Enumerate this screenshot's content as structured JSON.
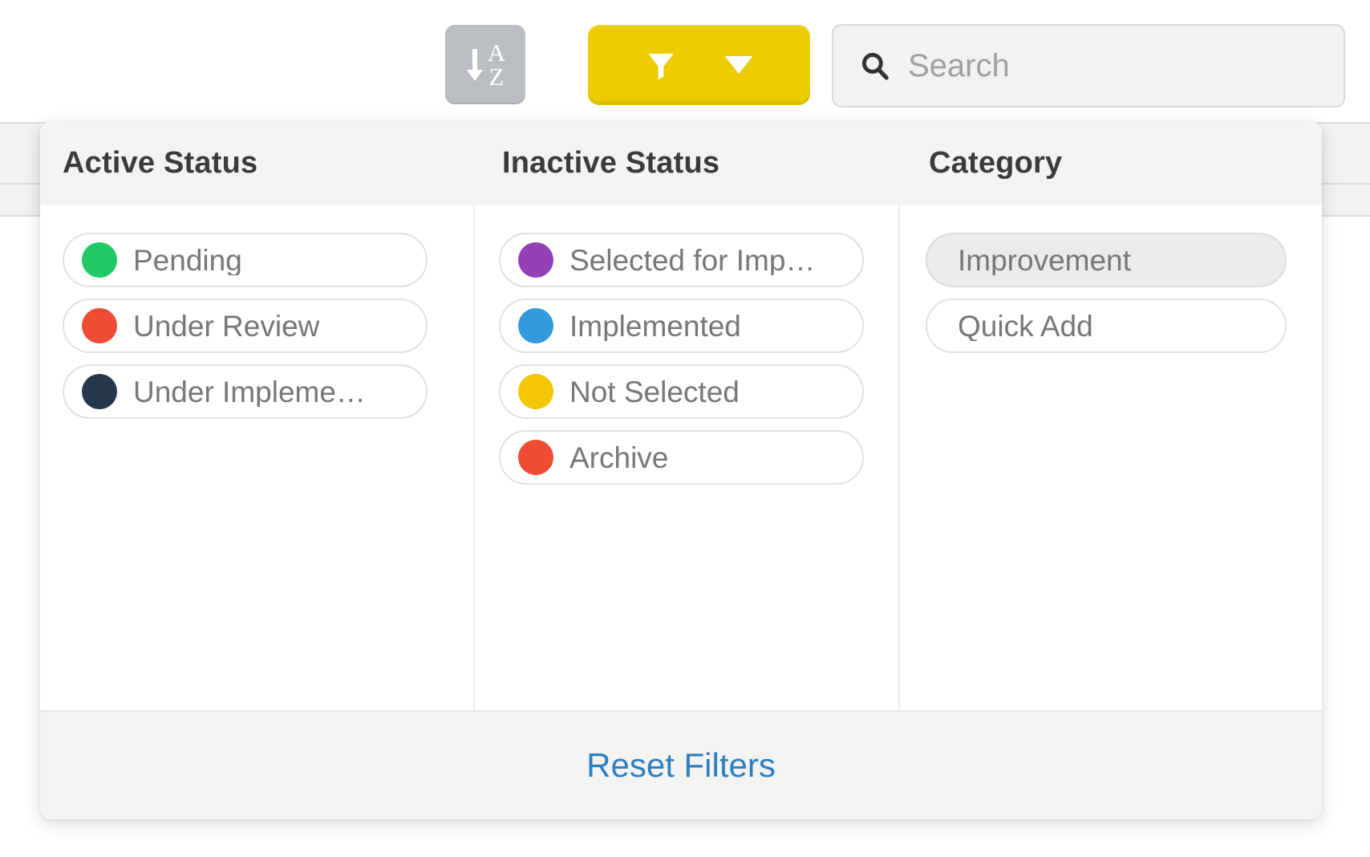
{
  "toolbar": {
    "sort_button": {
      "name": "sort-az-button",
      "letter_top": "A",
      "letter_bottom": "Z"
    },
    "filter_button": {
      "name": "filter-button",
      "color": "#eccb00"
    },
    "search": {
      "placeholder": "Search",
      "value": ""
    }
  },
  "filter_popover": {
    "columns": [
      {
        "title": "Active Status",
        "options": [
          {
            "label": "Pending",
            "color": "#1fca65",
            "selected": false
          },
          {
            "label": "Under Review",
            "color": "#ef4c35",
            "selected": false
          },
          {
            "label": "Under Impleme…",
            "color": "#26374c",
            "selected": false
          }
        ]
      },
      {
        "title": "Inactive Status",
        "options": [
          {
            "label": "Selected for Imp…",
            "color": "#9441b5",
            "selected": false
          },
          {
            "label": "Implemented",
            "color": "#339ade",
            "selected": false
          },
          {
            "label": "Not Selected",
            "color": "#f3c502",
            "selected": false
          },
          {
            "label": "Archive",
            "color": "#ef4c35",
            "selected": false
          }
        ]
      },
      {
        "title": "Category",
        "options": [
          {
            "label": "Improvement",
            "color": null,
            "selected": true
          },
          {
            "label": "Quick Add",
            "color": null,
            "selected": false
          }
        ]
      }
    ],
    "footer": {
      "reset_label": "Reset Filters",
      "link_color": "#2f7fbf"
    }
  }
}
